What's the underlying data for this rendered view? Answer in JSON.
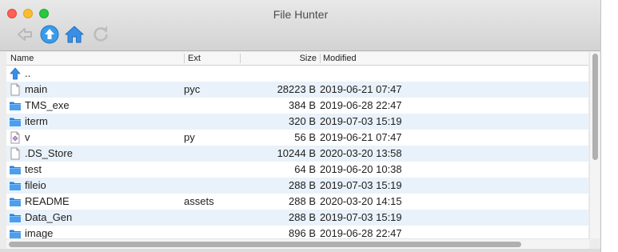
{
  "window": {
    "title": "File Hunter"
  },
  "toolbar": {
    "back_icon": "back-arrow-icon",
    "up_icon": "up-arrow-icon",
    "home_icon": "home-icon",
    "refresh_icon": "refresh-icon"
  },
  "columns": {
    "name": "Name",
    "ext": "Ext",
    "size": "Size",
    "modified": "Modified"
  },
  "rows": [
    {
      "icon": "parent-dir-icon",
      "name": "..",
      "ext": "",
      "size": "",
      "modified": ""
    },
    {
      "icon": "file-icon",
      "name": "main",
      "ext": "pyc",
      "size": "28223 B",
      "modified": "2019-06-21 07:47"
    },
    {
      "icon": "folder-icon",
      "name": "TMS_exe",
      "ext": "",
      "size": "384 B",
      "modified": "2019-06-28 22:47"
    },
    {
      "icon": "folder-icon",
      "name": "iterm",
      "ext": "",
      "size": "320 B",
      "modified": "2019-07-03 15:19"
    },
    {
      "icon": "script-file-icon",
      "name": "v",
      "ext": "py",
      "size": "56 B",
      "modified": "2019-06-21 07:47"
    },
    {
      "icon": "file-icon",
      "name": ".DS_Store",
      "ext": "",
      "size": "10244 B",
      "modified": "2020-03-20 13:58"
    },
    {
      "icon": "folder-icon",
      "name": "test",
      "ext": "",
      "size": "64 B",
      "modified": "2019-06-20 10:38"
    },
    {
      "icon": "folder-icon",
      "name": "fileio",
      "ext": "",
      "size": "288 B",
      "modified": "2019-07-03 15:19"
    },
    {
      "icon": "folder-icon",
      "name": "README",
      "ext": "assets",
      "size": "288 B",
      "modified": "2020-03-20 14:15"
    },
    {
      "icon": "folder-icon",
      "name": "Data_Gen",
      "ext": "",
      "size": "288 B",
      "modified": "2019-07-03 15:19"
    },
    {
      "icon": "folder-icon",
      "name": "image",
      "ext": "",
      "size": "896 B",
      "modified": "2019-06-28 22:47"
    }
  ],
  "colors": {
    "row_alt": "#e9f2fa",
    "folder": "#3a8ee6",
    "accent": "#2a90e8",
    "close": "#fe5f57",
    "minimize": "#febc2e",
    "maximize": "#28c840"
  }
}
